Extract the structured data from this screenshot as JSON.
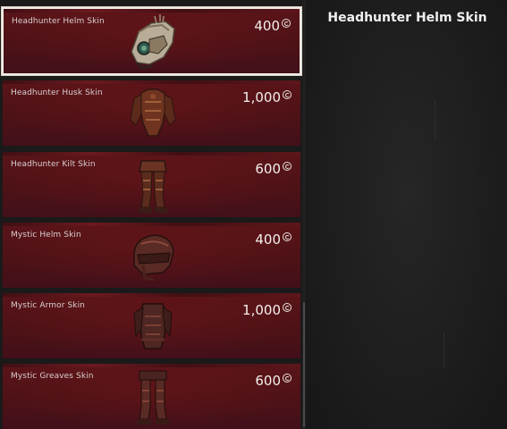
{
  "items": [
    {
      "name": "Headhunter Helm Skin",
      "price": "400",
      "image": "headhunter-helm-icon",
      "selected": true
    },
    {
      "name": "Headhunter Husk Skin",
      "price": "1,000",
      "image": "headhunter-husk-icon",
      "selected": false
    },
    {
      "name": "Headhunter Kilt Skin",
      "price": "600",
      "image": "headhunter-kilt-icon",
      "selected": false
    },
    {
      "name": "Mystic Helm Skin",
      "price": "400",
      "image": "mystic-helm-icon",
      "selected": false
    },
    {
      "name": "Mystic Armor Skin",
      "price": "1,000",
      "image": "mystic-armor-icon",
      "selected": false
    },
    {
      "name": "Mystic Greaves Skin",
      "price": "600",
      "image": "mystic-greaves-icon",
      "selected": false
    }
  ],
  "detail": {
    "title": "Headhunter Helm Skin"
  },
  "colors": {
    "card": "#4d1216",
    "selected_border": "#f1ece6",
    "background": "#1a1919"
  },
  "currency_icon": "coin-icon"
}
